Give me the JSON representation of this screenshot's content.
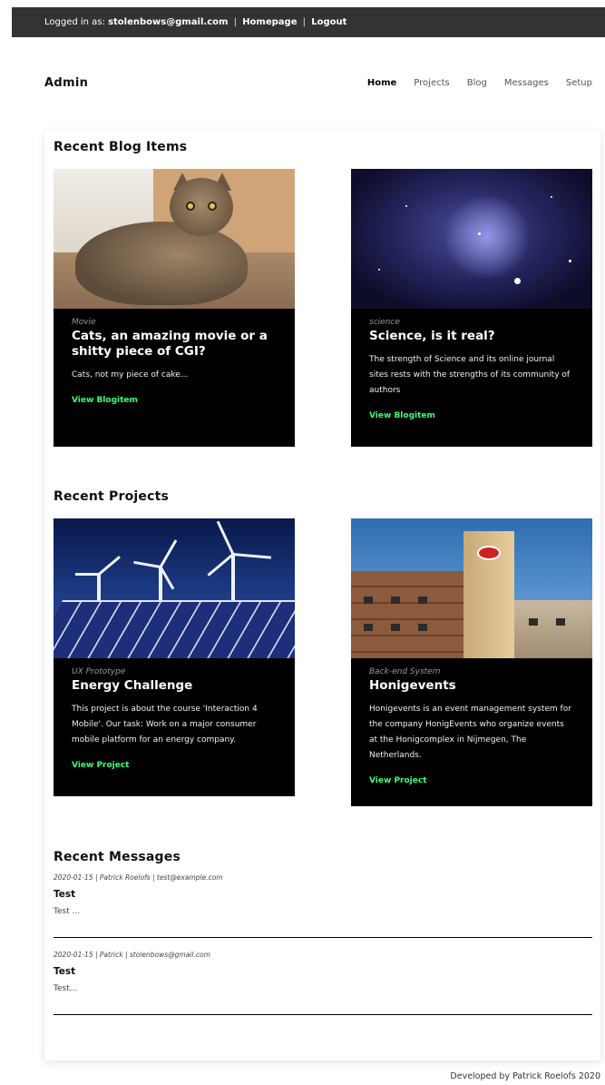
{
  "topbar": {
    "logged_in_prefix": "Logged in as:",
    "user_email": "stolenbows@gmail.com",
    "homepage_link": "Homepage",
    "logout_link": "Logout",
    "separator": "|"
  },
  "header": {
    "brand": "Admin",
    "nav": [
      "Home",
      "Projects",
      "Blog",
      "Messages",
      "Setup"
    ],
    "active_nav": "Home"
  },
  "blog": {
    "heading": "Recent Blog Items",
    "items": [
      {
        "category": "Movie",
        "title": "Cats, an amazing movie or a shitty piece of CGI?",
        "excerpt": "Cats, not my piece of cake...",
        "link": "View Blogitem",
        "image": "cat-photo"
      },
      {
        "category": "science",
        "title": "Science, is it real?",
        "excerpt": "The strength of Science and its online journal sites rests with the strengths of its community of authors",
        "link": "View Blogitem",
        "image": "galaxy-photo"
      }
    ]
  },
  "projects": {
    "heading": "Recent Projects",
    "items": [
      {
        "category": "UX Prototype",
        "title": "Energy Challenge",
        "excerpt": "This project is about the course 'Interaction 4 Mobile'. Our task: Work on a major consumer mobile platform for an energy company.",
        "link": "View Project",
        "image": "wind-turbines-photo"
      },
      {
        "category": "Back-end System",
        "title": "Honigevents",
        "excerpt": "Honigevents is an event management system for the company HonigEvents who organize events at the Honigcomplex in Nijmegen, The Netherlands.",
        "link": "View Project",
        "image": "honig-building-photo"
      }
    ]
  },
  "messages": {
    "heading": "Recent Messages",
    "items": [
      {
        "meta": "2020-01-15 | Patrick Roelofs | test@example.com",
        "subject": "Test",
        "body": "Test ..."
      },
      {
        "meta": "2020-01-15 | Patrick | stolenbows@gmail.com",
        "subject": "Test",
        "body": "Test..."
      }
    ]
  },
  "footer": {
    "text": "Developed by Patrick Roelofs 2020"
  },
  "colors": {
    "topbar_bg": "#333333",
    "tile_bg": "#000000",
    "link_green": "#3cff77"
  }
}
